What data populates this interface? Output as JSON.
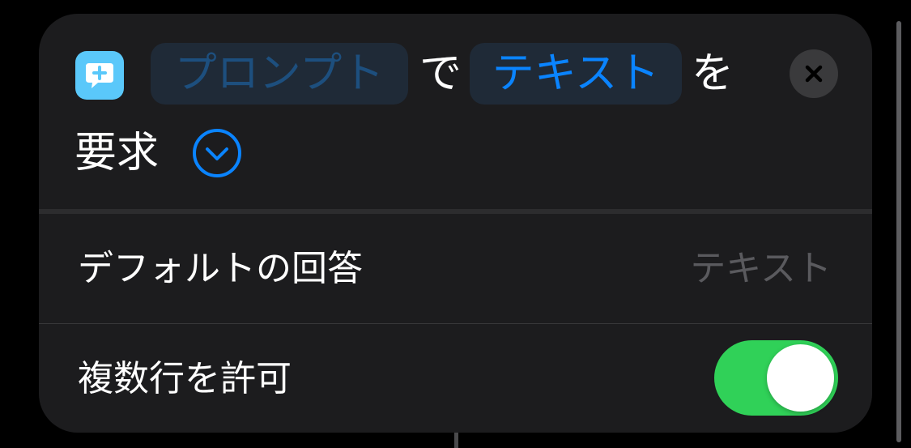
{
  "action": {
    "prompt_token": "プロンプト",
    "word_de": "で",
    "text_token": "テキスト",
    "word_wo": "を",
    "word_request": "要求"
  },
  "parameters": {
    "default_answer": {
      "label": "デフォルトの回答",
      "placeholder": "テキスト"
    },
    "allow_multiline": {
      "label": "複数行を許可",
      "enabled": true
    }
  },
  "icons": {
    "app": "message-plus-icon",
    "close": "close-icon",
    "expand": "chevron-down-circle-icon"
  },
  "colors": {
    "accent_blue": "#0a84ff",
    "toggle_green": "#30d158",
    "app_icon": "#5ac8fa",
    "card_background": "#1c1c1e"
  }
}
